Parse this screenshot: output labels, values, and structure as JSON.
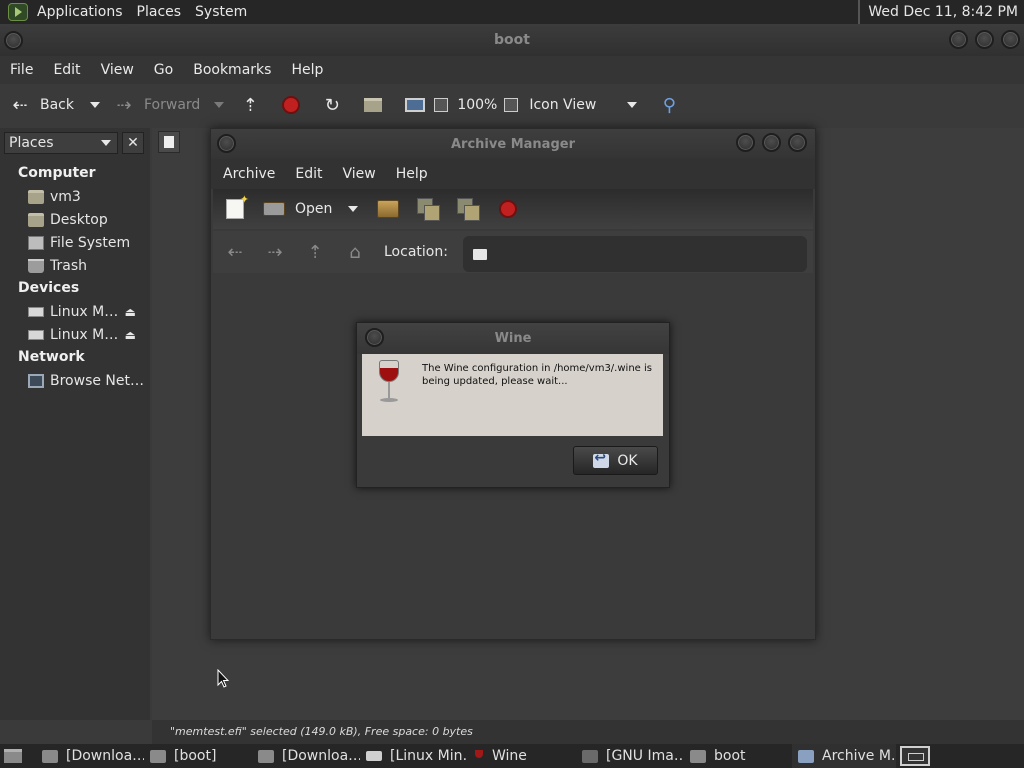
{
  "top_panel": {
    "menu": [
      "Applications",
      "Places",
      "System"
    ],
    "clock": "Wed Dec 11,  8:42 PM"
  },
  "nautilus": {
    "title": "boot",
    "menu": [
      "File",
      "Edit",
      "View",
      "Go",
      "Bookmarks",
      "Help"
    ],
    "toolbar": {
      "back": "Back",
      "forward": "Forward",
      "zoom": "100%",
      "view_mode": "Icon View"
    },
    "sidebar": {
      "selector": "Places",
      "computer_heading": "Computer",
      "computer_items": [
        {
          "label": "vm3",
          "icon": "home-folder-icon"
        },
        {
          "label": "Desktop",
          "icon": "desktop-folder-icon"
        },
        {
          "label": "File System",
          "icon": "filesystem-icon"
        },
        {
          "label": "Trash",
          "icon": "trash-icon"
        }
      ],
      "devices_heading": "Devices",
      "device_items": [
        {
          "label": "Linux M…",
          "icon": "drive-icon"
        },
        {
          "label": "Linux M…",
          "icon": "drive-icon"
        }
      ],
      "network_heading": "Network",
      "network_items": [
        {
          "label": "Browse Net…",
          "icon": "network-icon"
        }
      ]
    },
    "status": "\"memtest.efi\" selected (149.0 kB), Free space: 0 bytes"
  },
  "archive_manager": {
    "title": "Archive Manager",
    "menu": [
      "Archive",
      "Edit",
      "View",
      "Help"
    ],
    "open_label": "Open",
    "location_label": "Location:",
    "location_value": ""
  },
  "wine_dialog": {
    "title": "Wine",
    "message": "The Wine configuration in /home/vm3/.wine is being updated, please wait...",
    "ok_label": "OK"
  },
  "taskbar": {
    "items": [
      {
        "label": "[Downloa…",
        "icon": "folder-icon"
      },
      {
        "label": "[boot]",
        "icon": "folder-icon"
      },
      {
        "label": "[Downloa…",
        "icon": "folder-icon"
      },
      {
        "label": "[Linux Min…",
        "icon": "drive-icon"
      },
      {
        "label": "Wine",
        "icon": "wine-icon"
      },
      {
        "label": "[GNU Ima…",
        "icon": "gimp-icon"
      },
      {
        "label": "boot",
        "icon": "folder-icon"
      },
      {
        "label": "Archive M…",
        "icon": "archive-icon"
      }
    ]
  },
  "colors": {
    "panel": "#262626",
    "window_bg": "#3a3a3a",
    "dialog_body": "#d6d2cb",
    "stop_red": "#c0201f"
  }
}
